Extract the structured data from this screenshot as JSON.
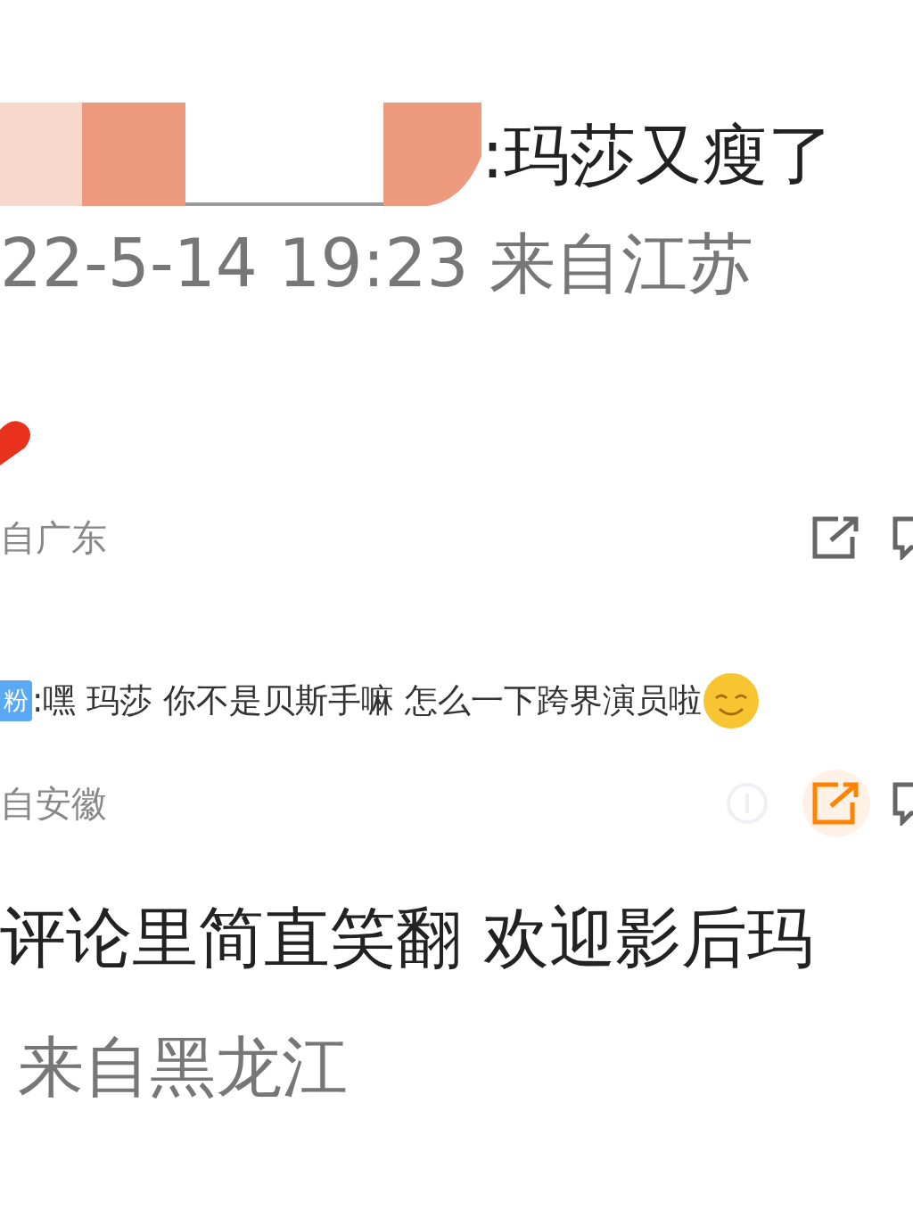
{
  "post": {
    "text": ":玛莎又瘦了",
    "meta": "22-5-14 19:23 来自江苏"
  },
  "comments": [
    {
      "kind": "emoji",
      "location": "自广东",
      "actions": [
        {
          "kind": "share",
          "highlighted": false
        },
        {
          "kind": "comment",
          "highlighted": false
        }
      ]
    },
    {
      "kind": "text",
      "badge": "粉",
      "text": ":嘿 玛莎 你不是贝斯手嘛 怎么一下跨界演员啦",
      "location": "自安徽",
      "actions": [
        {
          "kind": "info",
          "highlighted": false
        },
        {
          "kind": "share",
          "highlighted": true
        },
        {
          "kind": "comment",
          "highlighted": false
        }
      ]
    },
    {
      "kind": "large",
      "text": "评论里简直笑翻 欢迎影后玛",
      "location": "来自黑龙江"
    }
  ]
}
